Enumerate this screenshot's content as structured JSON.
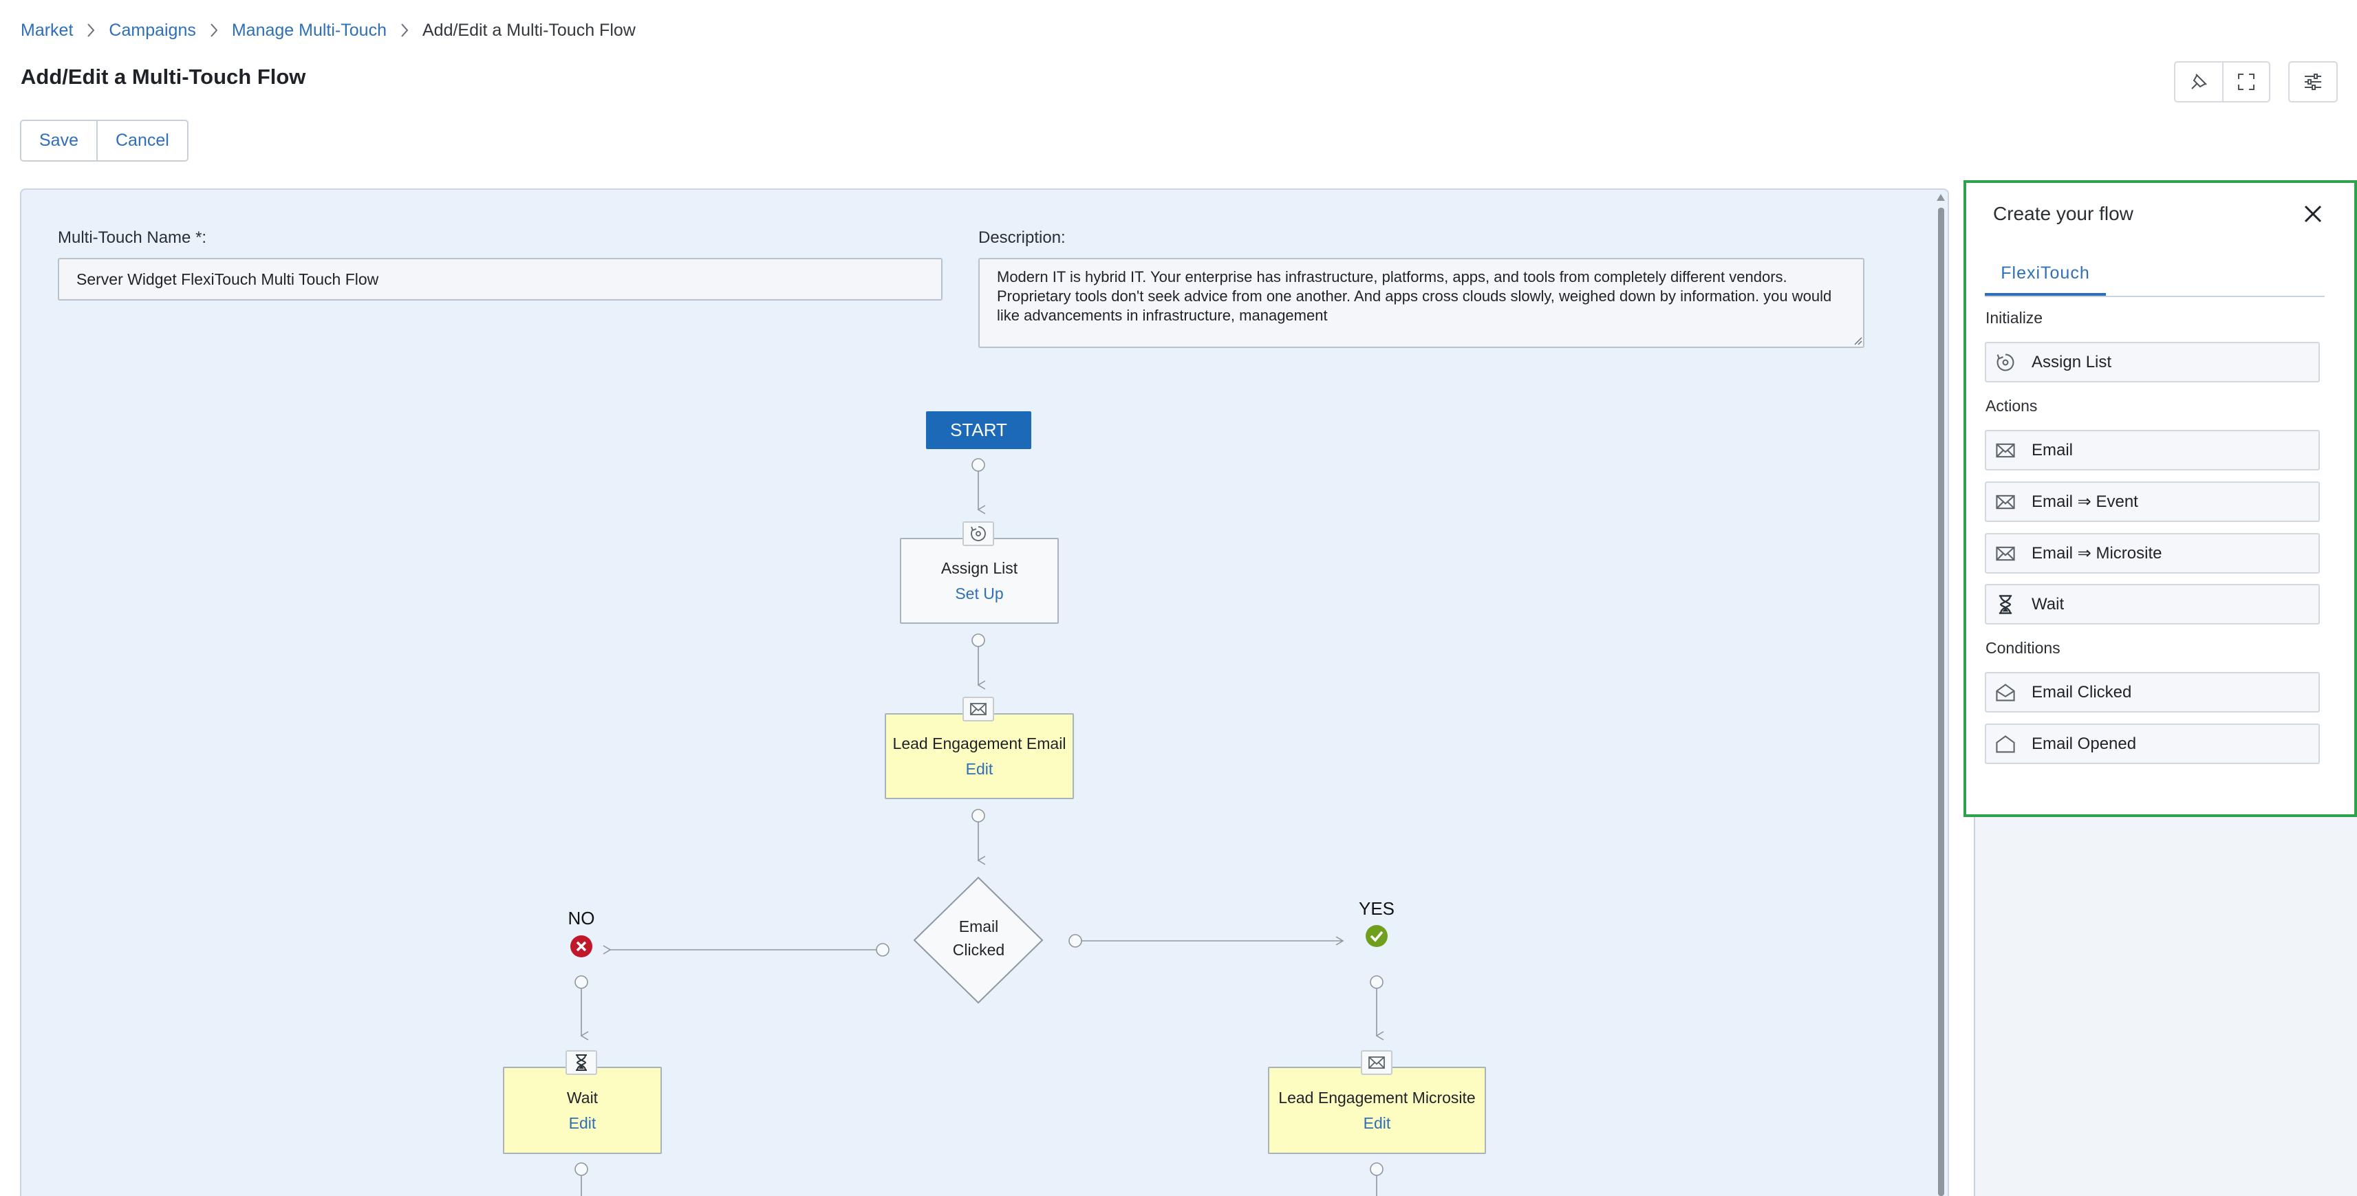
{
  "breadcrumb": {
    "items": [
      "Market",
      "Campaigns",
      "Manage Multi-Touch"
    ],
    "current": "Add/Edit a Multi-Touch Flow"
  },
  "page": {
    "title": "Add/Edit a Multi-Touch Flow"
  },
  "actions": {
    "save_label": "Save",
    "cancel_label": "Cancel"
  },
  "toolbar": {
    "icons": [
      "pin-icon",
      "expand-icon",
      "settings-sliders-icon"
    ]
  },
  "form": {
    "name_label": "Multi-Touch Name *:",
    "name_value": "Server Widget FlexiTouch Multi Touch Flow",
    "description_label": "Description:",
    "description_value": "Modern IT is hybrid IT. Your enterprise has infrastructure, platforms, apps, and tools from completely different vendors. Proprietary tools don't seek advice from one another. And apps cross clouds slowly, weighed down by information. you would like advancements in infrastructure, management"
  },
  "flow": {
    "start_label": "START",
    "assign_list": {
      "title": "Assign List",
      "link": "Set Up"
    },
    "email_node": {
      "title": "Lead Engagement Email",
      "link": "Edit"
    },
    "condition_line1": "Email",
    "condition_line2": "Clicked",
    "no_label": "NO",
    "yes_label": "YES",
    "wait_node": {
      "title": "Wait",
      "link": "Edit"
    },
    "microsite_node": {
      "title": "Lead Engagement Microsite",
      "link": "Edit"
    }
  },
  "panel": {
    "title": "Create your flow",
    "tab": "FlexiTouch",
    "sections": {
      "initialize": "Initialize",
      "actions": "Actions",
      "conditions": "Conditions"
    },
    "initialize_items": [
      {
        "label": "Assign List",
        "icon": "assign-list-icon"
      }
    ],
    "action_items": [
      {
        "label": "Email",
        "icon": "envelope-icon"
      },
      {
        "label": "Email ⇒ Event",
        "icon": "envelope-icon"
      },
      {
        "label": "Email ⇒ Microsite",
        "icon": "envelope-icon"
      },
      {
        "label": "Wait",
        "icon": "hourglass-icon"
      }
    ],
    "condition_items": [
      {
        "label": "Email Clicked",
        "icon": "open-envelope-icon"
      },
      {
        "label": "Email Opened",
        "icon": "open-envelope-icon"
      }
    ]
  },
  "colors": {
    "accent": "#2f6fb8",
    "start": "#1b69b7",
    "canvas": "#e9f1fb",
    "action_node": "#fdfdc2",
    "panel_highlight": "#2ea24a",
    "no_status": "#c0182a",
    "yes_status": "#6f9f1c"
  }
}
